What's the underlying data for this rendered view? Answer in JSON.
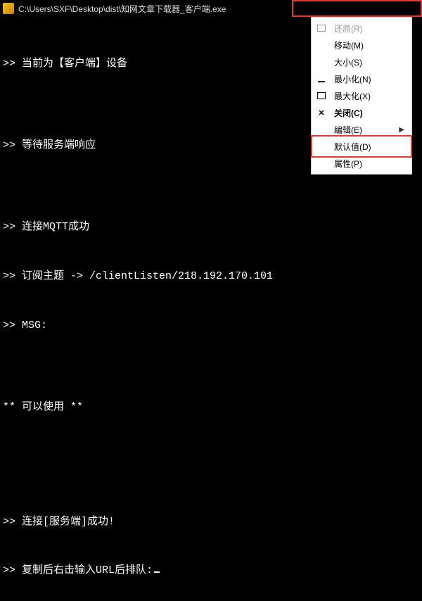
{
  "titlebar": {
    "path": "C:\\Users\\SXF\\Desktop\\dist\\知网文章下载器_客户端.exe"
  },
  "console": {
    "lines": [
      ">> 当前为【客户端】设备",
      "",
      ">> 等待服务端响应",
      "",
      ">> 连接MQTT成功",
      ">> 订阅主题 -> /clientListen/218.192.170.101",
      ">> MSG:",
      "",
      "** 可以使用 **",
      "",
      "",
      ">> 连接[服务端]成功!",
      ">> 复制后右击输入URL后排队:"
    ]
  },
  "menu": {
    "items": [
      {
        "key": "restore",
        "label": "还原(R)",
        "icon": "restore",
        "disabled": true,
        "submenu": false
      },
      {
        "key": "move",
        "label": "移动(M)",
        "icon": "",
        "disabled": false,
        "submenu": false
      },
      {
        "key": "size",
        "label": "大小(S)",
        "icon": "",
        "disabled": false,
        "submenu": false
      },
      {
        "key": "minimize",
        "label": "最小化(N)",
        "icon": "minimize",
        "disabled": false,
        "submenu": false
      },
      {
        "key": "maximize",
        "label": "最大化(X)",
        "icon": "maximize",
        "disabled": false,
        "submenu": false
      },
      {
        "key": "close",
        "label": "关闭(C)",
        "icon": "close",
        "disabled": false,
        "submenu": false
      },
      {
        "key": "edit",
        "label": "编辑(E)",
        "icon": "",
        "disabled": false,
        "submenu": true
      },
      {
        "key": "defaults",
        "label": "默认值(D)",
        "icon": "",
        "disabled": false,
        "submenu": false
      },
      {
        "key": "props",
        "label": "属性(P)",
        "icon": "",
        "disabled": false,
        "submenu": false
      }
    ]
  }
}
